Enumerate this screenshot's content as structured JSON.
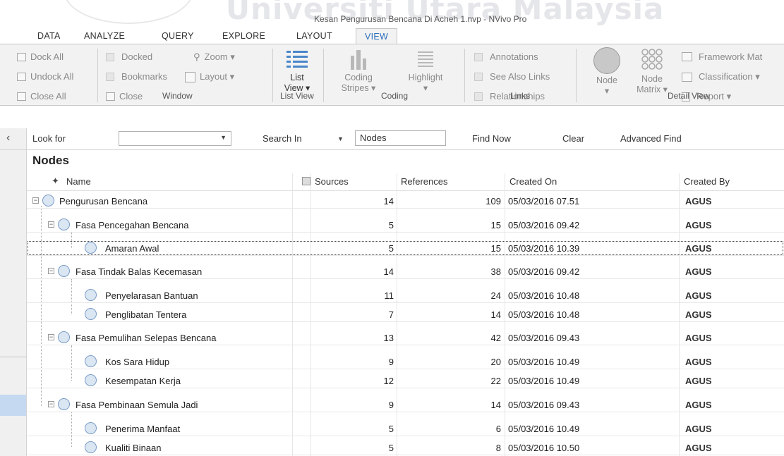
{
  "watermark": "Universiti Utara Malaysia",
  "window_title": "Kesan Pengurusan Bencana Di Acheh 1.nvp - NVivo Pro",
  "tabs": [
    "DATA",
    "ANALYZE",
    "QUERY",
    "EXPLORE",
    "LAYOUT",
    "VIEW"
  ],
  "ribbon": {
    "window": {
      "dock_all": "Dock All",
      "undock_all": "Undock All",
      "close_all": "Close All",
      "docked": "Docked",
      "bookmarks": "Bookmarks",
      "close": "Close",
      "zoom": "Zoom ▾",
      "layout": "Layout ▾",
      "group": "Window"
    },
    "list_view": {
      "label1": "List",
      "label2": "View ▾",
      "group": "List View"
    },
    "coding": {
      "stripes1": "Coding",
      "stripes2": "Stripes ▾",
      "highlight1": "Highlight",
      "highlight2": "▾",
      "group": "Coding"
    },
    "links": {
      "annotations": "Annotations",
      "see_also": "See Also Links",
      "relationships": "Relationships",
      "group": "Links"
    },
    "detail": {
      "node1": "Node",
      "node2": "▾",
      "matrix1": "Node",
      "matrix2": "Matrix ▾",
      "framework": "Framework Mat",
      "classification": "Classification ▾",
      "report": "Report ▾",
      "group": "Detail View"
    }
  },
  "findbar": {
    "look_for": "Look for",
    "search_in": "Search In",
    "search_value": "Nodes",
    "find_now": "Find Now",
    "clear": "Clear",
    "advanced_find": "Advanced Find"
  },
  "section_title": "Nodes",
  "columns": {
    "name": "Name",
    "sources": "Sources",
    "references": "References",
    "created_on": "Created On",
    "created_by": "Created By"
  },
  "rows": [
    {
      "name": "Pengurusan Bencana",
      "sources": "14",
      "references": "109",
      "created_on": "05/03/2016 07.51",
      "created_by": "AGUS"
    },
    {
      "name": "Fasa Pencegahan Bencana",
      "sources": "5",
      "references": "15",
      "created_on": "05/03/2016 09.42",
      "created_by": "AGUS"
    },
    {
      "name": "Amaran Awal",
      "sources": "5",
      "references": "15",
      "created_on": "05/03/2016 10.39",
      "created_by": "AGUS"
    },
    {
      "name": "Fasa Tindak Balas Kecemasan",
      "sources": "14",
      "references": "38",
      "created_on": "05/03/2016 09.42",
      "created_by": "AGUS"
    },
    {
      "name": "Penyelarasan Bantuan",
      "sources": "11",
      "references": "24",
      "created_on": "05/03/2016 10.48",
      "created_by": "AGUS"
    },
    {
      "name": "Penglibatan Tentera",
      "sources": "7",
      "references": "14",
      "created_on": "05/03/2016 10.48",
      "created_by": "AGUS"
    },
    {
      "name": "Fasa Pemulihan Selepas Bencana",
      "sources": "13",
      "references": "42",
      "created_on": "05/03/2016 09.43",
      "created_by": "AGUS"
    },
    {
      "name": "Kos Sara Hidup",
      "sources": "9",
      "references": "20",
      "created_on": "05/03/2016 10.49",
      "created_by": "AGUS"
    },
    {
      "name": "Kesempatan Kerja",
      "sources": "12",
      "references": "22",
      "created_on": "05/03/2016 10.49",
      "created_by": "AGUS"
    },
    {
      "name": "Fasa Pembinaan Semula Jadi",
      "sources": "9",
      "references": "14",
      "created_on": "05/03/2016 09.43",
      "created_by": "AGUS"
    },
    {
      "name": "Penerima Manfaat",
      "sources": "5",
      "references": "6",
      "created_on": "05/03/2016 10.49",
      "created_by": "AGUS"
    },
    {
      "name": "Kualiti Binaan",
      "sources": "5",
      "references": "8",
      "created_on": "05/03/2016 10.50",
      "created_by": "AGUS"
    }
  ]
}
